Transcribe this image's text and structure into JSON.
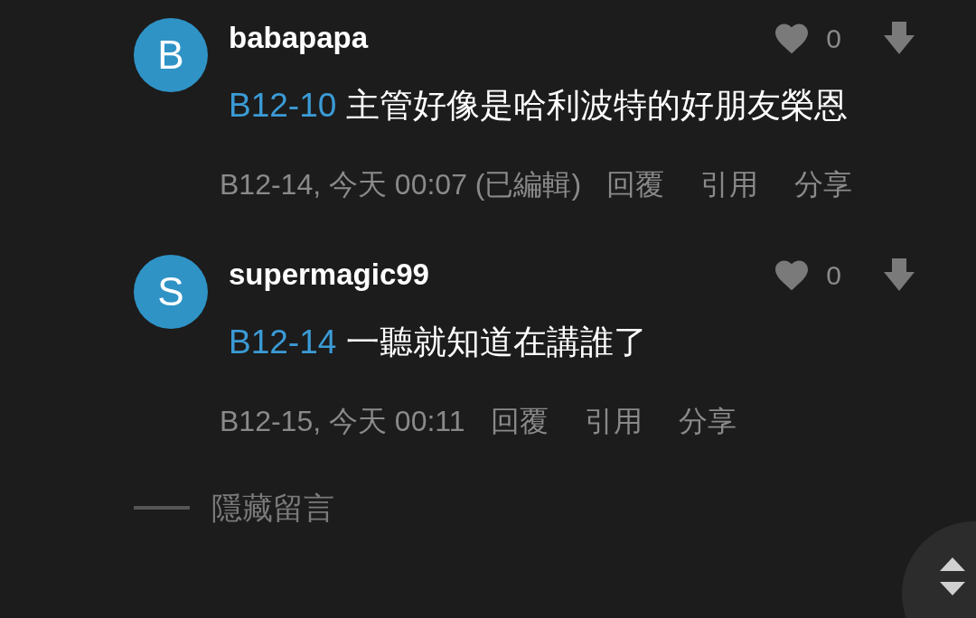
{
  "comments": [
    {
      "avatar_letter": "B",
      "username": "babapapa",
      "likes": "0",
      "reply_to": "B12-10",
      "text": "主管好像是哈利波特的好朋友榮恩",
      "meta": "B12-14, 今天 00:07 (已編輯)",
      "actions": [
        "回覆",
        "引用",
        "分享"
      ]
    },
    {
      "avatar_letter": "S",
      "username": "supermagic99",
      "likes": "0",
      "reply_to": "B12-14",
      "text": "一聽就知道在講誰了",
      "meta": "B12-15, 今天 00:11",
      "actions": [
        "回覆",
        "引用",
        "分享"
      ]
    }
  ],
  "hide_comments": "隱藏留言"
}
